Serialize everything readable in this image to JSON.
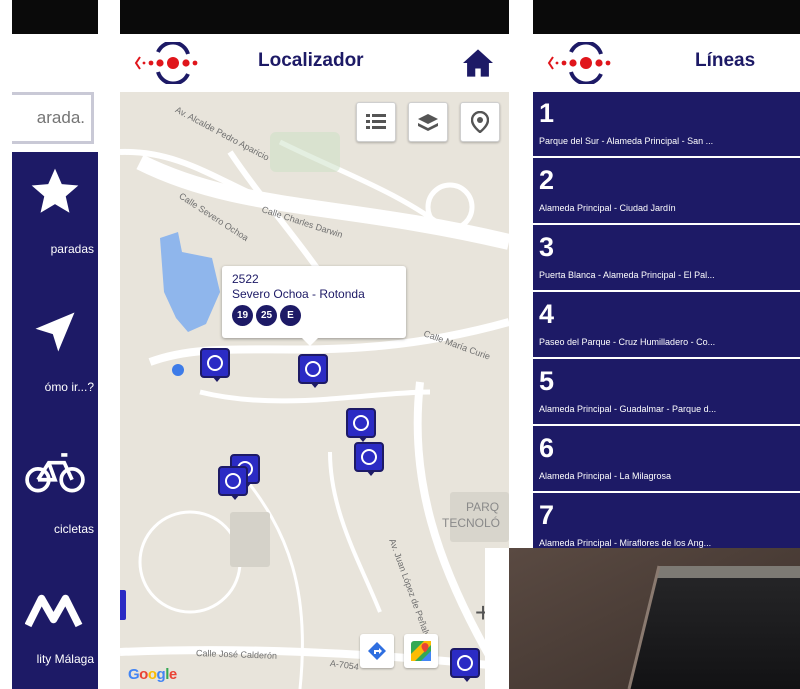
{
  "panel_left": {
    "search_placeholder": "arada.",
    "menu": [
      {
        "icon": "star-icon",
        "label": "paradas"
      },
      {
        "icon": "navigation-arrow-icon",
        "label": "ómo ir...?"
      },
      {
        "icon": "bicycle-icon",
        "label": "cicletas"
      },
      {
        "icon": "mobility-logo-icon",
        "label": "lity Málaga"
      }
    ]
  },
  "localizador": {
    "title": "Localizador",
    "map_controls": [
      "list-icon",
      "layers-icon",
      "location-pin-icon"
    ],
    "streets": [
      "Av. Alcalde Pedro Aparicio",
      "Calle Severo Ochoa",
      "Calle Charles Darwin",
      "Calle María Curie",
      "Av. Juan López de Peñalver",
      "Calle José Calderón",
      "A-7054"
    ],
    "area_label": [
      "PARQ",
      "TECNOLÓ"
    ],
    "popup": {
      "stop_code": "2522",
      "stop_name": "Severo Ochoa - Rotonda",
      "lines": [
        "19",
        "25",
        "E"
      ]
    },
    "google_logo": [
      "G",
      "o",
      "o",
      "g",
      "l",
      "e"
    ],
    "colors": {
      "primary": "#1d1a66",
      "stop_pin": "#2b2bc4",
      "map_bg": "#e8e4db",
      "park": "#c9dfc4",
      "water": "#8fb6ec"
    }
  },
  "lineas": {
    "title": "Líneas",
    "lines": [
      {
        "number": "1",
        "route": "Parque del Sur - Alameda Principal - San ..."
      },
      {
        "number": "2",
        "route": "Alameda Principal - Ciudad Jardín"
      },
      {
        "number": "3",
        "route": "Puerta Blanca - Alameda Principal - El Pal..."
      },
      {
        "number": "4",
        "route": "Paseo del Parque - Cruz Humilladero - Co..."
      },
      {
        "number": "5",
        "route": "Alameda Principal - Guadalmar - Parque d..."
      },
      {
        "number": "6",
        "route": "Alameda Principal - La Milagrosa"
      },
      {
        "number": "7",
        "route": "Alameda Principal - Miraflores de los Ang..."
      }
    ]
  }
}
